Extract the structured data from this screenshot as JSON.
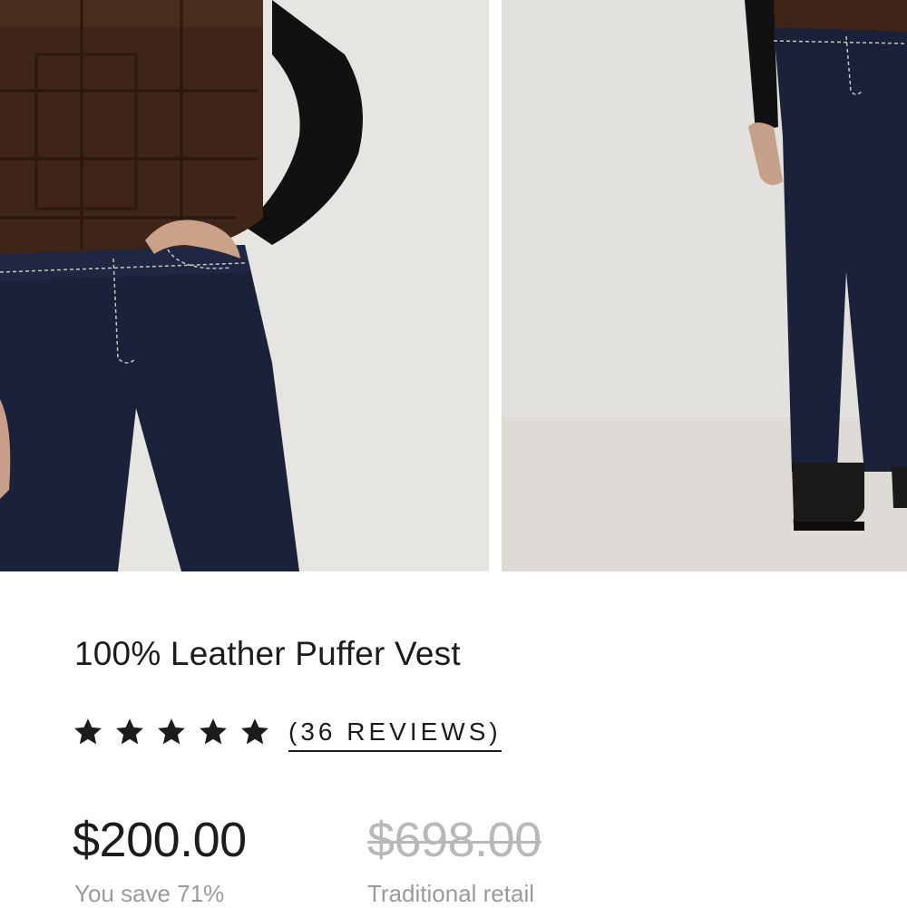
{
  "product": {
    "title": "100% Leather Puffer Vest",
    "rating": {
      "stars": 5,
      "reviews_label": "(36 REVIEWS)"
    },
    "price": "$200.00",
    "savings": "You save 71%",
    "retail_price": "$698.00",
    "retail_label": "Traditional retail"
  },
  "colors": {
    "text": "#1c1c1c",
    "muted": "#9a9a9a",
    "strike": "#b8b8b8",
    "photo_bg": "#e9e7e4"
  }
}
